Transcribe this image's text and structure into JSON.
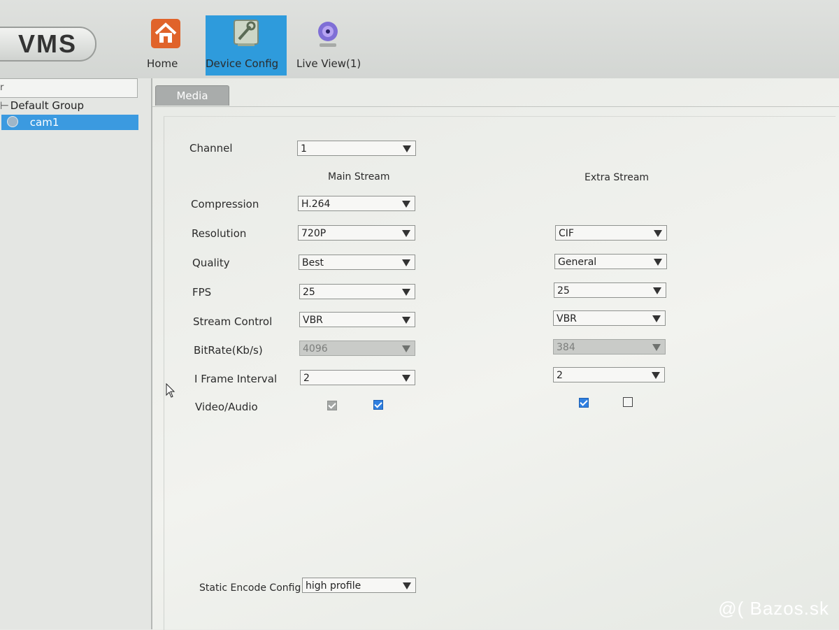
{
  "app": {
    "logo": "VMS"
  },
  "nav": [
    {
      "label": "Home",
      "icon": "home-icon"
    },
    {
      "label": "Device Config",
      "icon": "device-config-icon",
      "active": true
    },
    {
      "label": "Live View(1)",
      "icon": "live-view-icon"
    }
  ],
  "sidebar": {
    "search_value": "r",
    "group_label": "Default Group",
    "camera_label": "cam1"
  },
  "tabs": {
    "media": "Media"
  },
  "form": {
    "channel": {
      "label": "Channel",
      "value": "1"
    },
    "main_stream_header": "Main Stream",
    "extra_stream_header": "Extra Stream",
    "rows": {
      "compression": {
        "label": "Compression",
        "main": "H.264"
      },
      "resolution": {
        "label": "Resolution",
        "main": "720P",
        "extra": "CIF"
      },
      "quality": {
        "label": "Quality",
        "main": "Best",
        "extra": "General"
      },
      "fps": {
        "label": "FPS",
        "main": "25",
        "extra": "25"
      },
      "stream_control": {
        "label": "Stream Control",
        "main": "VBR",
        "extra": "VBR"
      },
      "bitrate": {
        "label": "BitRate(Kb/s)",
        "main": "4096",
        "extra": "384"
      },
      "iframe": {
        "label": "I Frame Interval",
        "main": "2",
        "extra": "2"
      },
      "video_audio": {
        "label": "Video/Audio",
        "main_video_checked": true,
        "main_audio_checked": true,
        "extra_video_checked": true,
        "extra_audio_checked": false
      }
    },
    "static_encode": {
      "label": "Static Encode Config",
      "value": "high profile"
    }
  },
  "watermark": "@( Bazos.sk",
  "colors": {
    "accent": "#2e9bdc",
    "selection": "#3b9ae0",
    "checkbox": "#2f7fe0"
  }
}
